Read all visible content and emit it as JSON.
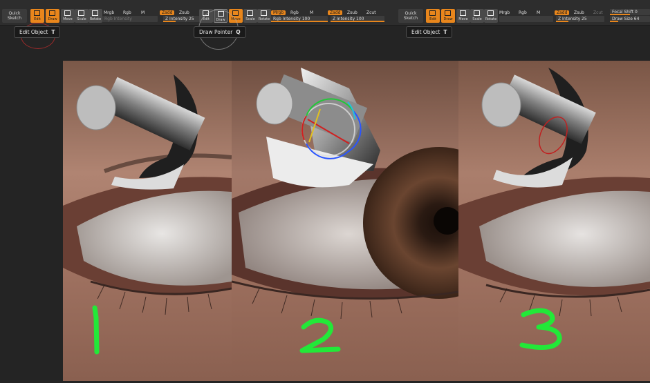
{
  "toolbar1": {
    "quick_sketch": "Quick Sketch",
    "edit": "Edit",
    "draw": "Draw",
    "move": "Move",
    "scale": "Scale",
    "rotate": "Rotate",
    "mrgb": "Mrgb",
    "rgb": "Rgb",
    "m": "M",
    "rgb_intensity": "Rgb Intensity",
    "zadd": "Zadd",
    "zsub": "Zsub",
    "z_intensity": "Z Intensity 25"
  },
  "toolbar2": {
    "edit": "Edit",
    "draw": "Draw",
    "move": "Move",
    "scale": "Scale",
    "rotate": "Rotate",
    "mrgb": "Mrgb",
    "rgb": "Rgb",
    "m": "M",
    "rgb_intensity": "Rgb Intensity 100",
    "zadd": "Zadd",
    "zsub": "Zsub",
    "zcut": "Zcut",
    "z_intensity": "Z Intensity 100"
  },
  "toolbar3": {
    "quick_sketch": "Quick Sketch",
    "edit": "Edit",
    "draw": "Draw",
    "move": "Move",
    "scale": "Scale",
    "rotate": "Rotate",
    "mrgb": "Mrgb",
    "rgb": "Rgb",
    "m": "M",
    "zadd": "Zadd",
    "zsub": "Zsub",
    "zcut": "Zcut",
    "z_intensity": "Z Intensity 25",
    "focal_shift": "Focal Shift 0",
    "draw_size": "Draw Size 64"
  },
  "tooltips": {
    "edit_object": "Edit Object",
    "edit_object_key": "T",
    "draw_pointer": "Draw Pointer",
    "draw_pointer_key": "Q",
    "edit_object_2": "Edit Object",
    "edit_object_2_key": "T"
  },
  "panels": [
    {
      "number": "1"
    },
    {
      "number": "2"
    },
    {
      "number": "3"
    }
  ],
  "colors": {
    "accent": "#e8861c",
    "annotation": "#22e838",
    "background": "#242424"
  }
}
